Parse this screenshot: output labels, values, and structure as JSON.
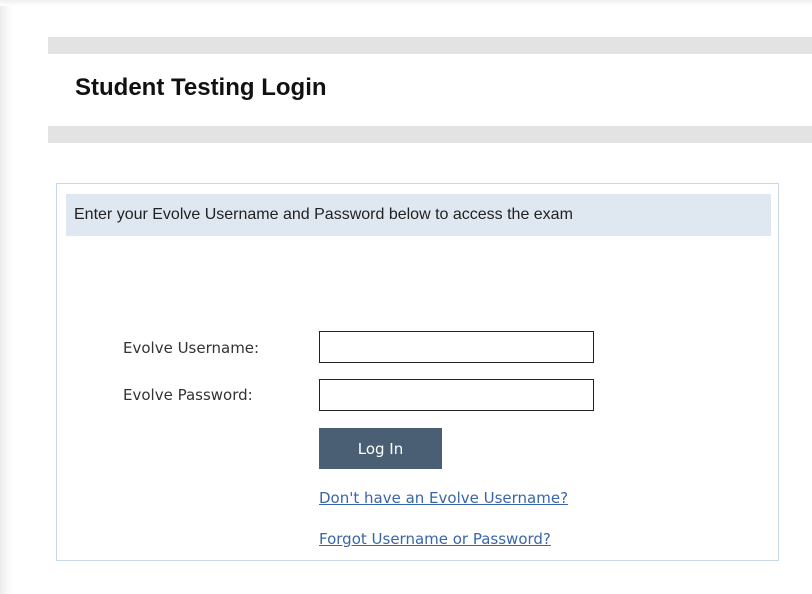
{
  "page": {
    "title": "Student Testing Login"
  },
  "login_panel": {
    "instructions": "Enter your Evolve Username and Password below to access the exam",
    "username": {
      "label": "Evolve Username:",
      "value": "",
      "placeholder": ""
    },
    "password": {
      "label": "Evolve Password:",
      "value": "",
      "placeholder": ""
    },
    "login_button_label": "Log In",
    "links": {
      "no_username": "Don't have an Evolve Username?",
      "forgot": "Forgot Username or Password?"
    }
  },
  "colors": {
    "accent_button": "#4a5f73",
    "link": "#3a66a8",
    "header_band": "#dfe8f1",
    "divider_band": "#e3e3e3"
  }
}
